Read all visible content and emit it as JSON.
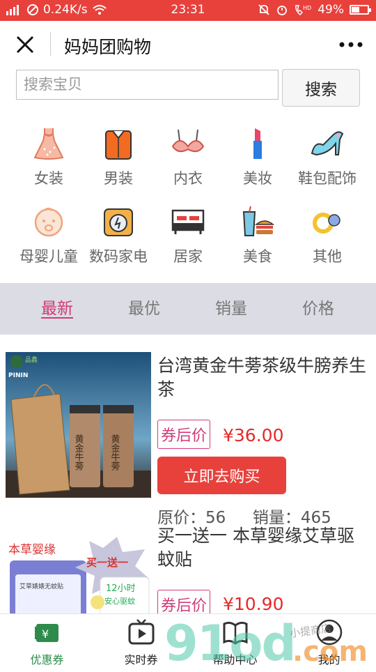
{
  "status_bar": {
    "network_speed": "0.24K/s",
    "time": "23:31",
    "battery_percent": "49%",
    "battery_level": 0.49
  },
  "header": {
    "title": "妈妈团购物"
  },
  "search": {
    "placeholder": "搜索宝贝",
    "button_label": "搜索"
  },
  "categories": [
    {
      "label": "女装",
      "icon": "dress-icon"
    },
    {
      "label": "男装",
      "icon": "shirt-icon"
    },
    {
      "label": "内衣",
      "icon": "bra-icon"
    },
    {
      "label": "美妆",
      "icon": "lipstick-icon"
    },
    {
      "label": "鞋包配饰",
      "icon": "high-heel-icon"
    },
    {
      "label": "母婴儿童",
      "icon": "baby-face-icon"
    },
    {
      "label": "数码家电",
      "icon": "appliance-icon"
    },
    {
      "label": "居家",
      "icon": "bed-icon"
    },
    {
      "label": "美食",
      "icon": "food-icon"
    },
    {
      "label": "其他",
      "icon": "rings-icon"
    }
  ],
  "sort_tabs": [
    {
      "label": "最新",
      "active": true
    },
    {
      "label": "最优",
      "active": false
    },
    {
      "label": "销量",
      "active": false
    },
    {
      "label": "价格",
      "active": false
    }
  ],
  "products": [
    {
      "name": "台湾黄金牛蒡茶级牛膀养生茶",
      "coupon_label": "券后价",
      "price": "¥36.00",
      "buy_label": "立即去购买",
      "original_price_label": "原价：56",
      "sales_label": "销量：465",
      "image_text": [
        "品鑫",
        "PININ",
        "黄金牛蒡"
      ]
    },
    {
      "name": "买一送一 本草婴缘艾草驱蚊贴",
      "coupon_label": "券后价",
      "price": "¥10.90",
      "image_text": [
        "本草婴缘",
        "买一送一",
        "12小时",
        "安心驱蚊",
        "艾草婊婊无蚊贴"
      ]
    }
  ],
  "tabbar": [
    {
      "label": "优惠券",
      "icon": "coupon-icon",
      "active": true
    },
    {
      "label": "实时券",
      "icon": "play-tv-icon",
      "active": false
    },
    {
      "label": "帮助中心",
      "icon": "book-icon",
      "active": false
    },
    {
      "label": "我的",
      "icon": "user-icon",
      "active": false
    }
  ],
  "watermark": {
    "big": "91od",
    "suffix": ".com",
    "small": "小提商店"
  },
  "colors": {
    "accent": "#e8413c",
    "sort_active": "#d13a7a",
    "price": "#e52a2a",
    "tab_active": "#2e8b4b",
    "sortbar_bg": "#dcdde4"
  }
}
